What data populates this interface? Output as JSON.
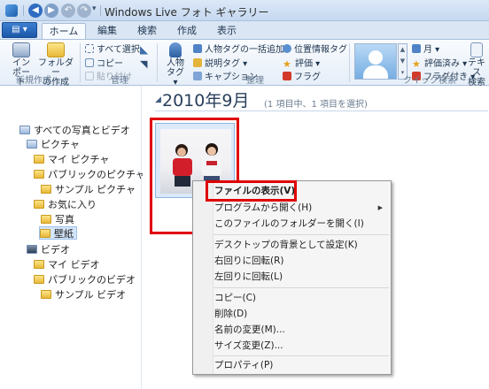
{
  "window": {
    "title": "Windows Live フォト ギャラリー"
  },
  "quick_access": {
    "back": "◀",
    "forward": "▶",
    "undo": "↶",
    "redo": "↷",
    "dropdown": "▾"
  },
  "app_menu": {
    "label": "▤ ▾"
  },
  "tabs": [
    {
      "label": "ホーム",
      "active": true
    },
    {
      "label": "編集",
      "active": false
    },
    {
      "label": "検索",
      "active": false
    },
    {
      "label": "作成",
      "active": false
    },
    {
      "label": "表示",
      "active": false
    }
  ],
  "ribbon": {
    "new_group": {
      "label": "新規作成",
      "import": {
        "line1": "イン",
        "line2": "ポート"
      },
      "new_folder": {
        "line1": "フォルダー",
        "line2": "の作成"
      }
    },
    "manage_group": {
      "label": "管理",
      "select_all": "すべて選択",
      "copy": "コピー",
      "paste": "貼り付け"
    },
    "organize_group": {
      "label": "整理",
      "people_tag": {
        "line1": "人物",
        "line2": "タグ ▾"
      },
      "bulk_people_tag": "人物タグの一括追加",
      "description_tag": "説明タグ ▾",
      "caption": "キャプション",
      "geotag": "位置情報タグ",
      "rating": "評価 ▾",
      "flag": "フラグ"
    },
    "quick_search_group": {
      "label": "クイック検索",
      "month": "月 ▾",
      "rated": "評価済み ▾",
      "flagged": "フラグ付き ▾",
      "text_search": {
        "line1": "テキス",
        "line2": "検索"
      }
    }
  },
  "sidebar": {
    "items": [
      {
        "label": "すべての写真とビデオ",
        "icon": "photo-library-icon",
        "level": 0
      },
      {
        "label": "ピクチャ",
        "icon": "pictures-library-icon",
        "level": 1
      },
      {
        "label": "マイ ピクチャ",
        "icon": "folder-icon",
        "level": 2
      },
      {
        "label": "パブリックのピクチャ",
        "icon": "folder-icon",
        "level": 2
      },
      {
        "label": "サンプル ピクチャ",
        "icon": "folder-icon",
        "level": 3
      },
      {
        "label": "お気に入り",
        "icon": "folder-icon",
        "level": 2
      },
      {
        "label": "写真",
        "icon": "folder-icon",
        "level": 3
      },
      {
        "label": "壁紙",
        "icon": "folder-icon",
        "level": 3,
        "selected": true
      },
      {
        "label": "ビデオ",
        "icon": "video-library-icon",
        "level": 1
      },
      {
        "label": "マイ ビデオ",
        "icon": "folder-icon",
        "level": 2
      },
      {
        "label": "パブリックのビデオ",
        "icon": "folder-icon",
        "level": 2
      },
      {
        "label": "サンプル ビデオ",
        "icon": "folder-icon",
        "level": 3
      }
    ]
  },
  "content": {
    "month_title": "2010年9月",
    "month_count": "(1 項目中、1 項目を選択)"
  },
  "context_menu": {
    "items": [
      {
        "label": "ファイルの表示(V)",
        "bold": true
      },
      {
        "label": "プログラムから開く(H)",
        "submenu": true
      },
      {
        "label": "このファイルのフォルダーを開く(I)"
      },
      {
        "separator": true
      },
      {
        "label": "デスクトップの背景として設定(K)"
      },
      {
        "label": "右回りに回転(R)"
      },
      {
        "label": "左回りに回転(L)"
      },
      {
        "separator": true
      },
      {
        "label": "コピー(C)"
      },
      {
        "label": "削除(D)"
      },
      {
        "label": "名前の変更(M)..."
      },
      {
        "label": "サイズ変更(Z)..."
      },
      {
        "separator": true
      },
      {
        "label": "プロパティ(P)"
      }
    ],
    "submenu_arrow": "▶"
  },
  "colors": {
    "highlight": "#e00000",
    "accent": "#1b57a8"
  }
}
